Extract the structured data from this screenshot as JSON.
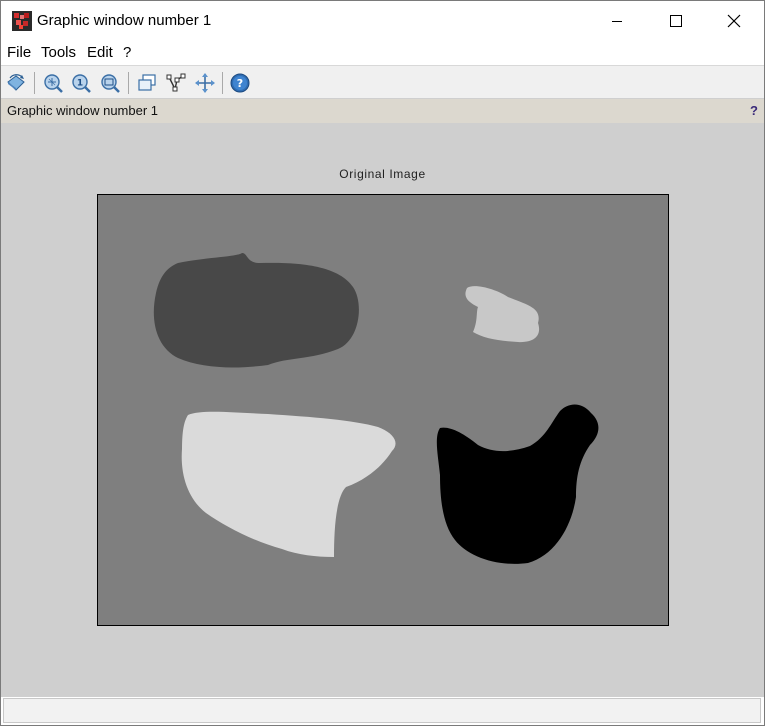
{
  "window": {
    "title": "Graphic window number 1",
    "controls": {
      "minimize": "minimize",
      "maximize": "maximize",
      "close": "close"
    }
  },
  "menu": [
    "File",
    "Tools",
    "Edit",
    "?"
  ],
  "toolbar": {
    "buttons": [
      "rotate-icon",
      "zoom-in-icon",
      "zoom-reset-icon",
      "zoom-out-icon",
      "datatip-icon",
      "polyline-icon",
      "pan-icon",
      "help-icon"
    ]
  },
  "infobar": {
    "text": "Graphic window number 1",
    "help": "?"
  },
  "figure": {
    "title": "Original Image",
    "background": "#7f7f7f",
    "regions": [
      {
        "name": "dark-gray-blob",
        "color": "#484848"
      },
      {
        "name": "light-gray-small-blob",
        "color": "#c8c8c8"
      },
      {
        "name": "light-gray-large-blob",
        "color": "#dadada"
      },
      {
        "name": "black-blob",
        "color": "#000000"
      }
    ]
  },
  "status": {
    "text": ""
  },
  "colors": {
    "canvas": "#cfcfcf",
    "infobar": "#dcd8cf",
    "toolbar": "#f0f0f0"
  }
}
